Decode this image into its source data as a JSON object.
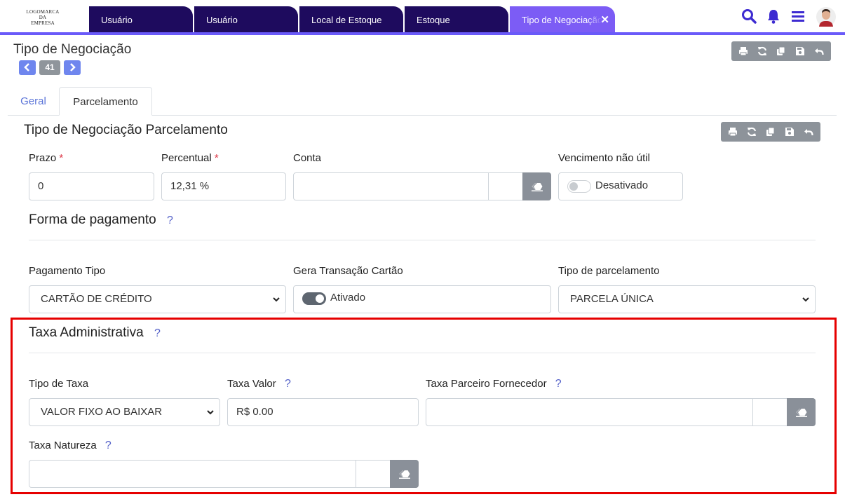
{
  "header": {
    "logo_lines": [
      "LOGOMARCA",
      "DA",
      "EMPRESA"
    ],
    "tabs": [
      {
        "label": "Usuário"
      },
      {
        "label": "Usuário"
      },
      {
        "label": "Local de Estoque"
      },
      {
        "label": "Estoque"
      },
      {
        "label": "Tipo de Negociação",
        "active": true
      }
    ],
    "icons": [
      "search-icon",
      "bell-icon",
      "menu-icon",
      "avatar"
    ]
  },
  "page": {
    "title": "Tipo de Negociação",
    "record_number": "41",
    "toolbar_icons": [
      "print-icon",
      "refresh-icon",
      "copy-icon",
      "save-icon",
      "undo-icon"
    ]
  },
  "subtabs": {
    "geral": "Geral",
    "parcelamento": "Parcelamento"
  },
  "section": {
    "title": "Tipo de Negociação Parcelamento"
  },
  "fields": {
    "prazo": {
      "label": "Prazo",
      "required_mark": "*",
      "value": "0"
    },
    "percentual": {
      "label": "Percentual",
      "required_mark": "*",
      "value": "12,31 %"
    },
    "conta": {
      "label": "Conta",
      "value": ""
    },
    "vencimento": {
      "label": "Vencimento não útil",
      "state": "Desativado"
    }
  },
  "forma_pagamento": {
    "title": "Forma de pagamento",
    "help": "?",
    "pagamento_tipo": {
      "label": "Pagamento Tipo",
      "value": "CARTÃO DE CRÉDITO"
    },
    "gera_transacao": {
      "label": "Gera Transação Cartão",
      "state": "Ativado"
    },
    "tipo_parcelamento": {
      "label": "Tipo de parcelamento",
      "value": "PARCELA ÚNICA"
    }
  },
  "taxa_administrativa": {
    "title": "Taxa Administrativa",
    "help": "?",
    "tipo_taxa": {
      "label": "Tipo de Taxa",
      "value": "VALOR FIXO AO BAIXAR"
    },
    "taxa_valor": {
      "label": "Taxa Valor",
      "help": "?",
      "value": "R$ 0.00"
    },
    "taxa_parceiro": {
      "label": "Taxa Parceiro Fornecedor",
      "help": "?",
      "value": ""
    },
    "taxa_natureza": {
      "label": "Taxa Natureza",
      "help": "?",
      "value": ""
    }
  },
  "colors": {
    "primary": "#1e0b5e",
    "accent": "#7c5cf5",
    "toolbar": "#8d939a",
    "highlight": "#e60000"
  }
}
